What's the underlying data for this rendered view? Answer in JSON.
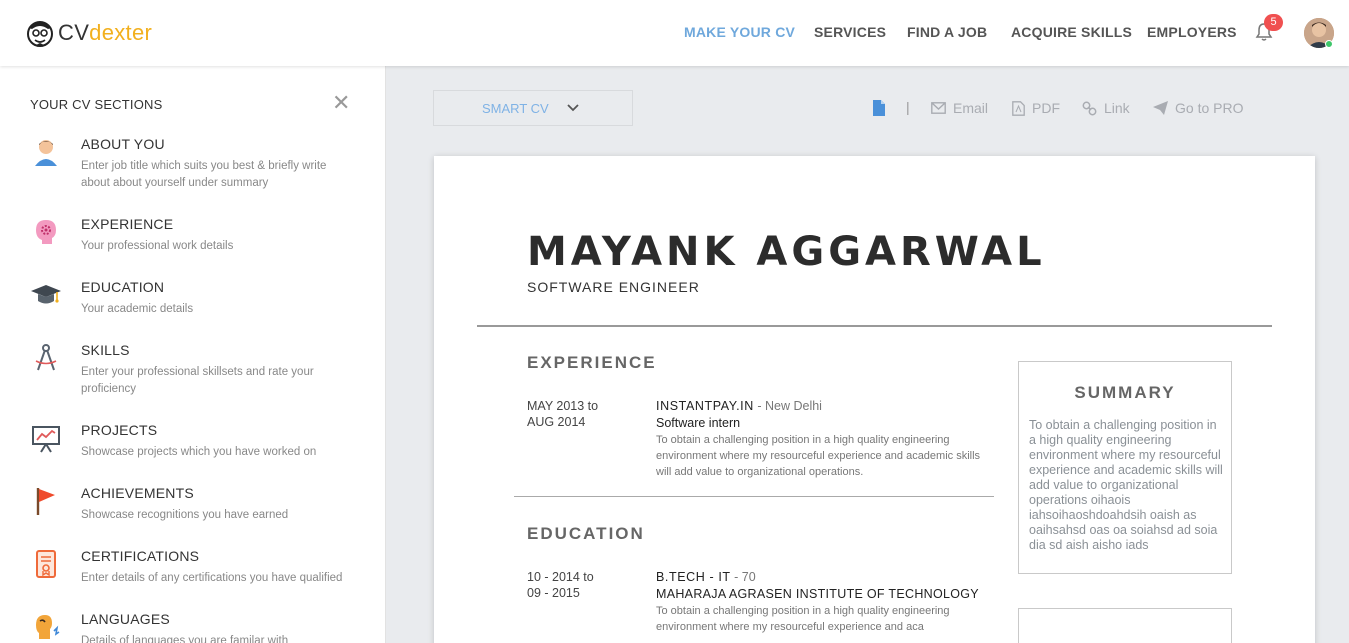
{
  "brand": {
    "part1": "CV",
    "part2": "dexter",
    "accent": "#f2b01e"
  },
  "nav": {
    "items": [
      "MAKE YOUR CV",
      "SERVICES",
      "FIND A JOB",
      "ACQUIRE SKILLS",
      "EMPLOYERS"
    ],
    "active_color": "#6fa8dc",
    "notifications": "5"
  },
  "sidebar": {
    "title": "YOUR CV SECTIONS",
    "close": "✕",
    "sections": [
      {
        "title": "ABOUT YOU",
        "desc": "Enter job title which suits you best & briefly write about about yourself under summary",
        "icon": "person-icon"
      },
      {
        "title": "EXPERIENCE",
        "desc": "Your professional work details",
        "icon": "brain-gear-icon"
      },
      {
        "title": "EDUCATION",
        "desc": "Your academic details",
        "icon": "graduation-cap-icon"
      },
      {
        "title": "SKILLS",
        "desc": "Enter your professional skillsets and rate your proficiency",
        "icon": "compass-icon"
      },
      {
        "title": "PROJECTS",
        "desc": "Showcase projects which you have worked on",
        "icon": "presentation-icon"
      },
      {
        "title": "ACHIEVEMENTS",
        "desc": "Showcase recognitions you have earned",
        "icon": "flag-icon"
      },
      {
        "title": "CERTIFICATIONS",
        "desc": "Enter details of any certifications you have qualified",
        "icon": "certificate-icon"
      },
      {
        "title": "LANGUAGES",
        "desc": "Details of languages you are familar with",
        "icon": "language-icon"
      }
    ]
  },
  "toolbar": {
    "template": "SMART CV",
    "separator": "|",
    "email": "Email",
    "pdf": "PDF",
    "link": "Link",
    "pro": "Go to PRO"
  },
  "cv": {
    "name": "MAYANK AGGARWAL",
    "role": "SOFTWARE ENGINEER",
    "experience_heading": "EXPERIENCE",
    "experience": {
      "date1": "MAY 2013 to",
      "date2": "AUG 2014",
      "org": "INSTANTPAY.IN",
      "dash": " - ",
      "location": "New Delhi",
      "position": "Software intern",
      "desc": "To obtain a challenging position in a high quality engineering environment where my resourceful experience and academic skills will add value to organizational operations."
    },
    "education_heading": "EDUCATION",
    "education": {
      "date1": "10 - 2014 to",
      "date2": "09 - 2015",
      "degree": "B.TECH - IT",
      "dash": " - ",
      "score": "70",
      "institute": "MAHARAJA AGRASEN INSTITUTE OF TECHNOLOGY",
      "desc": "To obtain a challenging position in a high quality engineering environment where my resourceful experience and aca"
    },
    "summary_heading": "SUMMARY",
    "summary": "To obtain a challenging position in a high quality engineering environment where my resourceful experience and academic skills will add value to organizational operations oihaois iahsoihaoshdoahdsih oaish as oaihsahsd oas oa soiahsd ad soia dia sd aish aisho iads"
  }
}
